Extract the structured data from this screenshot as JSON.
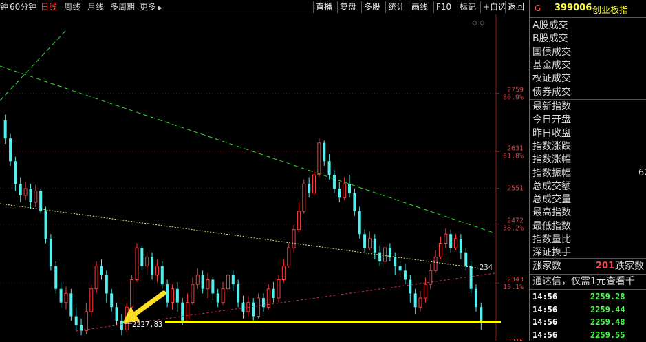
{
  "toolbar": {
    "periods": [
      {
        "label": "钟",
        "active": false
      },
      {
        "label": "60分钟",
        "active": false
      },
      {
        "label": "日线",
        "active": true
      },
      {
        "label": "周线",
        "active": false
      },
      {
        "label": "月线",
        "active": false
      },
      {
        "label": "多周期",
        "active": false
      },
      {
        "label": "更多",
        "active": false
      }
    ],
    "more_arrow": "▶",
    "buttons": [
      "直播",
      "复盘",
      "多股",
      "统计",
      "画线",
      "F10",
      "标记",
      "+自选",
      "返回"
    ]
  },
  "chart": {
    "price_ticks": [
      {
        "price": "2759",
        "pct": "80.9%"
      },
      {
        "price": "2631",
        "pct": "61.8%"
      },
      {
        "price": "2551",
        "pct": ""
      },
      {
        "price": "2472",
        "pct": "38.2%"
      },
      {
        "price": "2343",
        "pct": "19.1%"
      },
      {
        "price": "2215",
        "pct": ""
      }
    ],
    "low_label": "2227.83",
    "right_edge_label": "234",
    "corner_icons": "◇ ◇",
    "colors": {
      "up": "#ff3a3a",
      "down": "#54f0f0",
      "green_line": "#33dd33",
      "yellow_line": "#ffff00"
    },
    "candles": [
      {
        "o": 2700,
        "c": 2660,
        "h": 2712,
        "l": 2648
      },
      {
        "o": 2660,
        "c": 2610,
        "h": 2670,
        "l": 2600
      },
      {
        "o": 2610,
        "c": 2560,
        "h": 2620,
        "l": 2545
      },
      {
        "o": 2560,
        "c": 2535,
        "h": 2575,
        "l": 2520
      },
      {
        "o": 2535,
        "c": 2550,
        "h": 2565,
        "l": 2525
      },
      {
        "o": 2550,
        "c": 2520,
        "h": 2560,
        "l": 2505
      },
      {
        "o": 2520,
        "c": 2545,
        "h": 2558,
        "l": 2510
      },
      {
        "o": 2545,
        "c": 2500,
        "h": 2550,
        "l": 2495
      },
      {
        "o": 2500,
        "c": 2440,
        "h": 2510,
        "l": 2430
      },
      {
        "o": 2440,
        "c": 2380,
        "h": 2450,
        "l": 2370
      },
      {
        "o": 2380,
        "c": 2330,
        "h": 2390,
        "l": 2320
      },
      {
        "o": 2330,
        "c": 2300,
        "h": 2345,
        "l": 2290
      },
      {
        "o": 2300,
        "c": 2320,
        "h": 2335,
        "l": 2285
      },
      {
        "o": 2320,
        "c": 2270,
        "h": 2330,
        "l": 2260
      },
      {
        "o": 2270,
        "c": 2250,
        "h": 2290,
        "l": 2240
      },
      {
        "o": 2250,
        "c": 2238,
        "h": 2265,
        "l": 2228
      },
      {
        "o": 2238,
        "c": 2280,
        "h": 2300,
        "l": 2230
      },
      {
        "o": 2280,
        "c": 2330,
        "h": 2340,
        "l": 2270
      },
      {
        "o": 2330,
        "c": 2380,
        "h": 2390,
        "l": 2320
      },
      {
        "o": 2380,
        "c": 2360,
        "h": 2395,
        "l": 2350
      },
      {
        "o": 2360,
        "c": 2320,
        "h": 2370,
        "l": 2300
      },
      {
        "o": 2320,
        "c": 2290,
        "h": 2330,
        "l": 2280
      },
      {
        "o": 2290,
        "c": 2260,
        "h": 2300,
        "l": 2250
      },
      {
        "o": 2260,
        "c": 2240,
        "h": 2275,
        "l": 2228
      },
      {
        "o": 2240,
        "c": 2290,
        "h": 2300,
        "l": 2235
      },
      {
        "o": 2290,
        "c": 2350,
        "h": 2360,
        "l": 2285
      },
      {
        "o": 2350,
        "c": 2420,
        "h": 2430,
        "l": 2345
      },
      {
        "o": 2420,
        "c": 2380,
        "h": 2425,
        "l": 2370
      },
      {
        "o": 2380,
        "c": 2400,
        "h": 2410,
        "l": 2360
      },
      {
        "o": 2400,
        "c": 2360,
        "h": 2410,
        "l": 2350
      },
      {
        "o": 2360,
        "c": 2380,
        "h": 2395,
        "l": 2345
      },
      {
        "o": 2380,
        "c": 2340,
        "h": 2390,
        "l": 2330
      },
      {
        "o": 2340,
        "c": 2300,
        "h": 2350,
        "l": 2290
      },
      {
        "o": 2300,
        "c": 2330,
        "h": 2340,
        "l": 2285
      },
      {
        "o": 2330,
        "c": 2300,
        "h": 2345,
        "l": 2280
      },
      {
        "o": 2300,
        "c": 2260,
        "h": 2310,
        "l": 2250
      },
      {
        "o": 2260,
        "c": 2300,
        "h": 2320,
        "l": 2255
      },
      {
        "o": 2300,
        "c": 2340,
        "h": 2355,
        "l": 2295
      },
      {
        "o": 2340,
        "c": 2360,
        "h": 2375,
        "l": 2330
      },
      {
        "o": 2360,
        "c": 2330,
        "h": 2370,
        "l": 2320
      },
      {
        "o": 2330,
        "c": 2350,
        "h": 2365,
        "l": 2310
      },
      {
        "o": 2350,
        "c": 2320,
        "h": 2355,
        "l": 2305
      },
      {
        "o": 2320,
        "c": 2300,
        "h": 2330,
        "l": 2290
      },
      {
        "o": 2300,
        "c": 2330,
        "h": 2345,
        "l": 2295
      },
      {
        "o": 2330,
        "c": 2360,
        "h": 2370,
        "l": 2320
      },
      {
        "o": 2360,
        "c": 2340,
        "h": 2370,
        "l": 2325
      },
      {
        "o": 2340,
        "c": 2300,
        "h": 2350,
        "l": 2290
      },
      {
        "o": 2300,
        "c": 2280,
        "h": 2315,
        "l": 2265
      },
      {
        "o": 2280,
        "c": 2300,
        "h": 2315,
        "l": 2270
      },
      {
        "o": 2300,
        "c": 2270,
        "h": 2310,
        "l": 2258
      },
      {
        "o": 2270,
        "c": 2310,
        "h": 2320,
        "l": 2265
      },
      {
        "o": 2310,
        "c": 2290,
        "h": 2320,
        "l": 2280
      },
      {
        "o": 2290,
        "c": 2330,
        "h": 2340,
        "l": 2285
      },
      {
        "o": 2330,
        "c": 2310,
        "h": 2345,
        "l": 2300
      },
      {
        "o": 2310,
        "c": 2350,
        "h": 2360,
        "l": 2300
      },
      {
        "o": 2350,
        "c": 2380,
        "h": 2395,
        "l": 2345
      },
      {
        "o": 2380,
        "c": 2420,
        "h": 2430,
        "l": 2375
      },
      {
        "o": 2420,
        "c": 2460,
        "h": 2470,
        "l": 2410
      },
      {
        "o": 2460,
        "c": 2500,
        "h": 2520,
        "l": 2455
      },
      {
        "o": 2500,
        "c": 2560,
        "h": 2570,
        "l": 2495
      },
      {
        "o": 2560,
        "c": 2540,
        "h": 2575,
        "l": 2530
      },
      {
        "o": 2540,
        "c": 2580,
        "h": 2590,
        "l": 2535
      },
      {
        "o": 2580,
        "c": 2650,
        "h": 2660,
        "l": 2575
      },
      {
        "o": 2650,
        "c": 2610,
        "h": 2655,
        "l": 2600
      },
      {
        "o": 2610,
        "c": 2580,
        "h": 2625,
        "l": 2570
      },
      {
        "o": 2580,
        "c": 2550,
        "h": 2590,
        "l": 2540
      },
      {
        "o": 2550,
        "c": 2530,
        "h": 2565,
        "l": 2520
      },
      {
        "o": 2530,
        "c": 2560,
        "h": 2575,
        "l": 2525
      },
      {
        "o": 2560,
        "c": 2540,
        "h": 2580,
        "l": 2530
      },
      {
        "o": 2540,
        "c": 2500,
        "h": 2550,
        "l": 2490
      },
      {
        "o": 2500,
        "c": 2450,
        "h": 2510,
        "l": 2440
      },
      {
        "o": 2450,
        "c": 2420,
        "h": 2460,
        "l": 2410
      },
      {
        "o": 2420,
        "c": 2440,
        "h": 2455,
        "l": 2415
      },
      {
        "o": 2440,
        "c": 2410,
        "h": 2450,
        "l": 2395
      },
      {
        "o": 2410,
        "c": 2390,
        "h": 2425,
        "l": 2380
      },
      {
        "o": 2390,
        "c": 2420,
        "h": 2430,
        "l": 2385
      },
      {
        "o": 2420,
        "c": 2400,
        "h": 2430,
        "l": 2390
      },
      {
        "o": 2400,
        "c": 2380,
        "h": 2410,
        "l": 2360
      },
      {
        "o": 2380,
        "c": 2370,
        "h": 2390,
        "l": 2355
      },
      {
        "o": 2370,
        "c": 2350,
        "h": 2385,
        "l": 2340
      },
      {
        "o": 2350,
        "c": 2320,
        "h": 2360,
        "l": 2300
      },
      {
        "o": 2320,
        "c": 2290,
        "h": 2330,
        "l": 2275
      },
      {
        "o": 2290,
        "c": 2310,
        "h": 2325,
        "l": 2280
      },
      {
        "o": 2310,
        "c": 2340,
        "h": 2355,
        "l": 2300
      },
      {
        "o": 2340,
        "c": 2370,
        "h": 2385,
        "l": 2330
      },
      {
        "o": 2370,
        "c": 2400,
        "h": 2415,
        "l": 2365
      },
      {
        "o": 2400,
        "c": 2430,
        "h": 2445,
        "l": 2395
      },
      {
        "o": 2430,
        "c": 2450,
        "h": 2462,
        "l": 2420
      },
      {
        "o": 2450,
        "c": 2420,
        "h": 2460,
        "l": 2410
      },
      {
        "o": 2420,
        "c": 2440,
        "h": 2450,
        "l": 2415
      },
      {
        "o": 2440,
        "c": 2410,
        "h": 2450,
        "l": 2395
      },
      {
        "o": 2410,
        "c": 2380,
        "h": 2420,
        "l": 2370
      },
      {
        "o": 2380,
        "c": 2330,
        "h": 2390,
        "l": 2320
      },
      {
        "o": 2330,
        "c": 2290,
        "h": 2340,
        "l": 2280
      },
      {
        "o": 2290,
        "c": 2259,
        "h": 2300,
        "l": 2240
      }
    ]
  },
  "panel": {
    "code_letter": "G",
    "code": "399006",
    "name": "创业板指",
    "labels1": [
      "A股成交",
      "B股成交",
      "国债成交",
      "基金成交",
      "权证成交",
      "债券成交"
    ],
    "labels2": [
      "最新指数",
      "今日开盘",
      "昨日收盘",
      "指数涨跌",
      "指数涨幅",
      "指数振幅",
      "总成交额",
      "总成交量",
      "最高指数",
      "最低指数",
      "指数量比",
      "深证换手"
    ],
    "amplitude_value": "62",
    "rise_label": "涨家数",
    "rise_value": "201",
    "fall_label": "跌家数",
    "promo": "通达信，仅需1元查看千",
    "ticks": [
      {
        "time": "14:56",
        "price": "2259.28"
      },
      {
        "time": "14:56",
        "price": "2259.44"
      },
      {
        "time": "14:56",
        "price": "2259.48"
      },
      {
        "time": "14:56",
        "price": "2259.55"
      }
    ]
  }
}
